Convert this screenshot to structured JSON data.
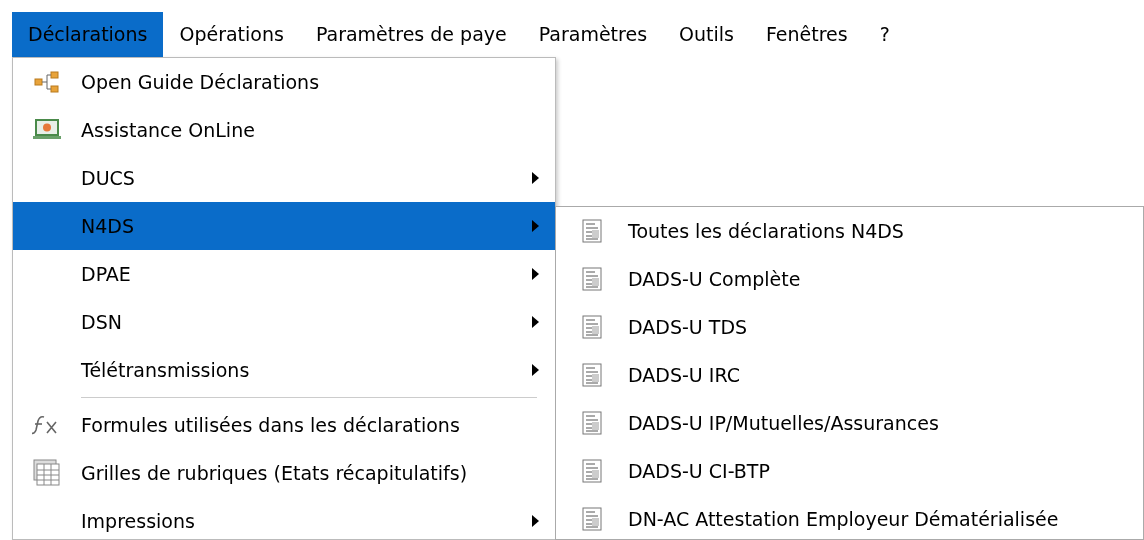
{
  "menubar": [
    {
      "label": "Déclarations",
      "selected": true
    },
    {
      "label": "Opérations",
      "selected": false
    },
    {
      "label": "Paramètres de paye",
      "selected": false
    },
    {
      "label": "Paramètres",
      "selected": false
    },
    {
      "label": "Outils",
      "selected": false
    },
    {
      "label": "Fenêtres",
      "selected": false
    },
    {
      "label": "?",
      "selected": false
    }
  ],
  "menu": [
    {
      "kind": "item",
      "label": "Open Guide Déclarations",
      "submenu": false,
      "selected": false
    },
    {
      "kind": "item",
      "label": "Assistance OnLine",
      "submenu": false,
      "selected": false
    },
    {
      "kind": "item",
      "label": "DUCS",
      "submenu": true,
      "selected": false
    },
    {
      "kind": "item",
      "label": "N4DS",
      "submenu": true,
      "selected": true
    },
    {
      "kind": "item",
      "label": "DPAE",
      "submenu": true,
      "selected": false
    },
    {
      "kind": "item",
      "label": "DSN",
      "submenu": true,
      "selected": false
    },
    {
      "kind": "item",
      "label": "Télétransmissions",
      "submenu": true,
      "selected": false
    },
    {
      "kind": "separator"
    },
    {
      "kind": "item",
      "label": "Formules utilisées dans les déclarations",
      "submenu": false,
      "selected": false
    },
    {
      "kind": "item",
      "label": "Grilles de rubriques (Etats récapitulatifs)",
      "submenu": false,
      "selected": false
    },
    {
      "kind": "item",
      "label": "Impressions",
      "submenu": true,
      "selected": false
    }
  ],
  "submenu": [
    {
      "label": "Toutes les déclarations N4DS"
    },
    {
      "label": "DADS-U Complète"
    },
    {
      "label": "DADS-U TDS"
    },
    {
      "label": "DADS-U IRC"
    },
    {
      "label": "DADS-U IP/Mutuelles/Assurances"
    },
    {
      "label": "DADS-U CI-BTP"
    },
    {
      "label": "DN-AC Attestation Employeur Dématérialisée"
    }
  ]
}
